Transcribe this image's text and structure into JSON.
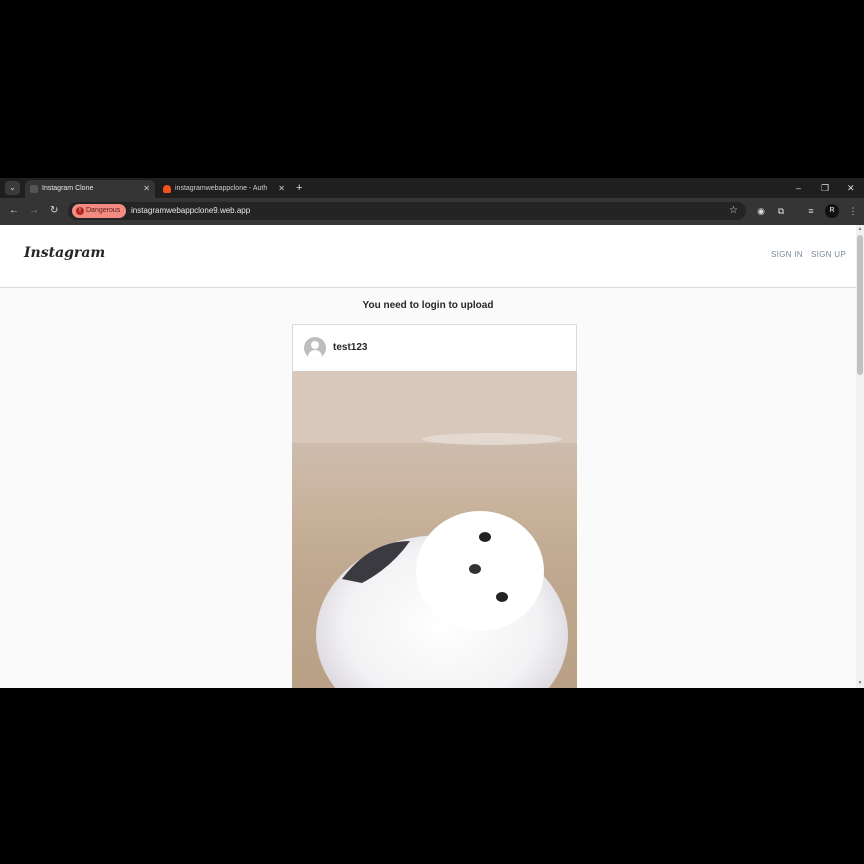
{
  "browser": {
    "tabs": [
      {
        "label": "Instagram Clone",
        "active": true
      },
      {
        "label": "instagramwebappclone - Authe",
        "active": false
      }
    ],
    "new_tab": "+",
    "window": {
      "minimize": "–",
      "restore": "❐",
      "close": "✕"
    },
    "nav": {
      "back": "←",
      "forward": "→",
      "reload": "↻"
    },
    "security_chip": "Dangerous",
    "url": "instagramwebappclone9.web.app",
    "profile_initial": "R",
    "colors": {
      "tabstrip": "#1f1f1f",
      "toolbar": "#353535",
      "danger": "#f28b82"
    }
  },
  "app": {
    "brand": "Instagram",
    "sign_in": "SIGN IN",
    "sign_up": "SIGN UP",
    "notice": "You need to login to upload"
  },
  "post": {
    "username": "test123",
    "image_subject": "white fluffy bird photo"
  }
}
